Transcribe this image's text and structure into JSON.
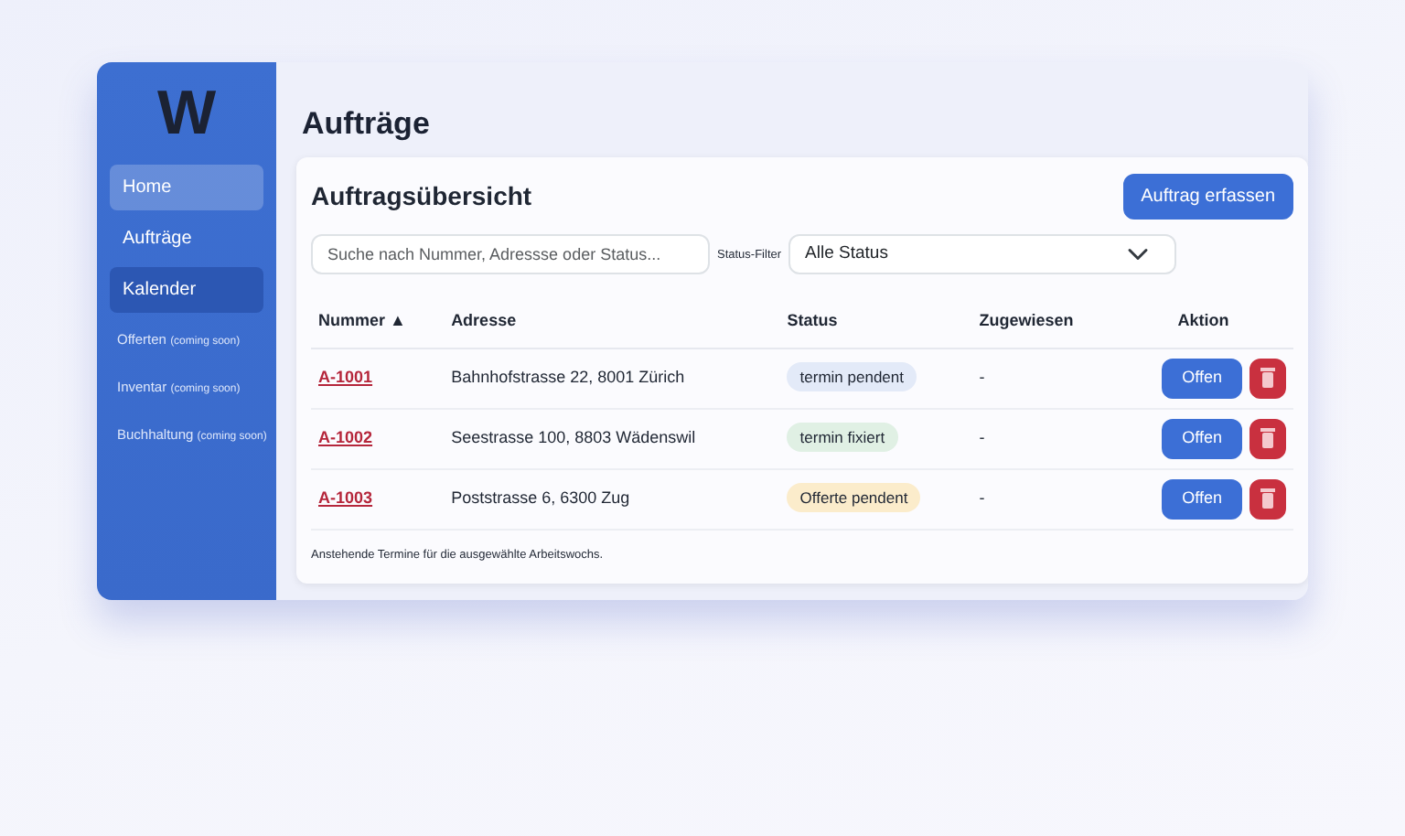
{
  "sidebar": {
    "logo": "W",
    "items": [
      {
        "label": "Home",
        "hovered": true,
        "selected": false
      },
      {
        "label": "Aufträge",
        "hovered": false,
        "selected": false
      },
      {
        "label": "Kalender",
        "hovered": false,
        "selected": true
      },
      {
        "label": "Offerten",
        "note": "(coming soon)",
        "hovered": false,
        "selected": false
      },
      {
        "label": "Inventar",
        "note": "(coming soon)",
        "hovered": false,
        "selected": false
      },
      {
        "label": "Buchhaltung",
        "note": "(coming soon)",
        "hovered": false,
        "selected": false
      }
    ]
  },
  "page_title": "Aufträge",
  "card": {
    "title": "Auftragsübersicht",
    "add_button": "Auftrag erfassen",
    "search": {
      "placeholder": "Suche nach Nummer, Adressse oder Status..."
    },
    "filter": {
      "label": "Status-Filter",
      "value": "Alle Status"
    },
    "table": {
      "columns": [
        {
          "label": "Nummer",
          "sort_indicator": "▲"
        },
        {
          "label": "Adresse"
        },
        {
          "label": "Status"
        },
        {
          "label": "Zugewiesen"
        },
        {
          "label": "Aktion"
        }
      ],
      "rows": [
        {
          "number": "A-1001",
          "address": "Bahnhofstrasse 22, 8001 Zürich",
          "status": "termin pendent",
          "color": "#e3eaf8",
          "assigned": "-",
          "action": "Offen"
        },
        {
          "number": "A-1002",
          "address": "Seestrasse 100, 8803 Wädenswil",
          "status": "termin fixiert",
          "color": "#e0f0e4",
          "assigned": "-",
          "action": "Offen"
        },
        {
          "number": "A-1003",
          "address": "Poststrasse 6, 6300 Zug",
          "status": "Offerte pendent",
          "color": "#fbeccb",
          "assigned": "-",
          "action": "Offen"
        }
      ]
    },
    "footnote": "Anstehende Termine für die ausgewählte Arbeitswochs."
  }
}
